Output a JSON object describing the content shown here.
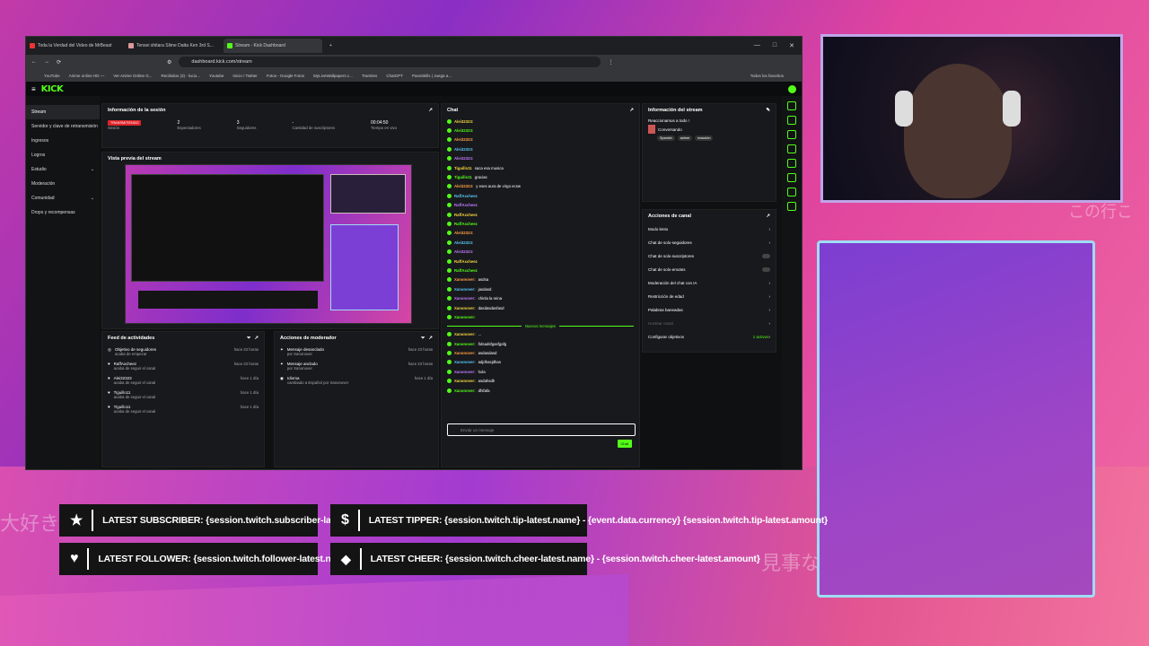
{
  "overlay": {
    "subscriber": "LATEST SUBSCRIBER: {session.twitch.subscriber-latest.name}",
    "follower": "LATEST FOLLOWER: {session.twitch.follower-latest.name}",
    "tipper": "LATEST TIPPER: {session.twitch.tip-latest.name} - {event.data.currency} {session.twitch.tip-latest.amount}",
    "cheer": "LATEST CHEER: {session.twitch.cheer-latest.name} - {session.twitch.cheer-latest.amount}",
    "jp_left": "大好き",
    "jp_right_top": "この行こ",
    "jp_right_bottom": "見事な"
  },
  "browser": {
    "tabs": [
      "Toda la Verdad del Video de MrBeast",
      "Tensei shitara Slime Datta Ken 3rd S...",
      "Stream - Kick Dashboard"
    ],
    "url": "dashboard.kick.com/stream",
    "bookmarks": [
      "YouTube",
      "Anime online HD —",
      "Ver Anime Online G...",
      "Recibidos (3) - lucio...",
      "Youtube",
      "Inicio / Twitter",
      "Fotos - Google Fotos",
      "MyLiveWallpapers.c...",
      "Tramites",
      "ChatGPT",
      "PassSkills | Juega a...",
      "Todos los favoritos"
    ]
  },
  "kick": {
    "logo": "KICK",
    "sidebar": [
      "Stream",
      "Servidor y clave de retransmisión",
      "Ingresos",
      "Logros",
      "Estudio",
      "Moderación",
      "Comunidad",
      "Drops y recompensas"
    ],
    "session": {
      "title": "Información de la sesión",
      "live_badge": "TRANSMITIENDO",
      "stats": [
        {
          "value": "",
          "label": "Sesión"
        },
        {
          "value": "2",
          "label": "Espectadores"
        },
        {
          "value": "3",
          "label": "Seguidores"
        },
        {
          "value": "-",
          "label": "Cantidad de suscriptores"
        },
        {
          "value": "00:04:50",
          "label": "Tiempo en vivo"
        }
      ]
    },
    "preview_title": "Vista previa del stream",
    "feed": {
      "title": "Feed de actividades",
      "items": [
        {
          "name": "Objetivo de seguidores",
          "desc": "acaba de empezar",
          "time": "hace 23 horas"
        },
        {
          "name": "RaffAxcheez",
          "desc": "acaba de seguir el canal",
          "time": "hace 23 horas"
        },
        {
          "name": "Alei32323",
          "desc": "acaba de seguir el canal",
          "time": "hace 1 día"
        },
        {
          "name": "Tiguillo11",
          "desc": "acaba de seguir el canal",
          "time": "hace 1 día"
        },
        {
          "name": "Tiguillo11",
          "desc": "acaba de seguir el canal",
          "time": "hace 1 día"
        }
      ]
    },
    "mod": {
      "title": "Acciones de moderador",
      "items": [
        {
          "name": "Mensaje desanclado",
          "desc": "por Xanonover",
          "time": "hace 23 horas"
        },
        {
          "name": "Mensaje anclado",
          "desc": "por Xanonover",
          "time": "hace 23 horas"
        },
        {
          "name": "Idioma",
          "desc": "cambiado a Español por Xanonover",
          "time": "hace 1 día"
        }
      ]
    },
    "chat": {
      "title": "Chat",
      "lines": [
        {
          "u": "Alei32323:",
          "t": ""
        },
        {
          "u": "Alei32323:",
          "t": ""
        },
        {
          "u": "Alei32323:",
          "t": ""
        },
        {
          "u": "Alei32323:",
          "t": ""
        },
        {
          "u": "Alei32323:",
          "t": ""
        },
        {
          "u": "Tiguillo11",
          "t": "saca esa musica"
        },
        {
          "u": "Tiguillo11",
          "t": "gracias"
        },
        {
          "u": "Alei32323:",
          "t": "y eses aura de virgo ecsw"
        },
        {
          "u": "RaffAxcheez",
          "t": ""
        },
        {
          "u": "RaffAxcheez",
          "t": ""
        },
        {
          "u": "RaffAxcheez",
          "t": ""
        },
        {
          "u": "RaffAxcheez",
          "t": ""
        },
        {
          "u": "Alei32323:",
          "t": ""
        },
        {
          "u": "Alei32323:",
          "t": ""
        },
        {
          "u": "Alei32323:",
          "t": ""
        },
        {
          "u": "RaffAxcheez",
          "t": ""
        },
        {
          "u": "RaffAxcheez",
          "t": ""
        },
        {
          "u": "Xanonover:",
          "t": "asdsa"
        },
        {
          "u": "Xanonover:",
          "t": "jasdasd"
        },
        {
          "u": "Xanonover:",
          "t": "chinla la reina"
        },
        {
          "u": "Xanonover:",
          "t": "dasdasdasfasd"
        },
        {
          "u": "Xanonover:",
          "t": ""
        }
      ],
      "divider": "Nuevos mensajes",
      "new_lines": [
        {
          "u": "Xanonover:",
          "t": "..."
        },
        {
          "u": "Xanonover:",
          "t": "ñdsadsfgasfgafg"
        },
        {
          "u": "Xanonover:",
          "t": "asdasdasd"
        },
        {
          "u": "Xanonover:",
          "t": "adjdhasjdhas"
        },
        {
          "u": "Xanonover:",
          "t": "hola"
        },
        {
          "u": "Xanonover:",
          "t": "asdahsdh"
        },
        {
          "u": "Xanonover:",
          "t": "dfsfafa"
        }
      ],
      "placeholder": "Enviar un mensaje",
      "send": "Chat"
    },
    "stream_info": {
      "title": "Información del stream",
      "desc": "Reaccionamos a todo !",
      "category": "Conversando",
      "tags": [
        "Spanish",
        "anime",
        "reacción"
      ]
    },
    "actions": {
      "title": "Acciones de canal",
      "items": [
        "Modo lento",
        "Chat de solo-seguidores",
        "Chat de solo-suscriptores",
        "Chat de solo-emotes",
        "Moderación del chat con IA",
        "Restricción de edad",
        "Palabras baneadas",
        "Hostear canal",
        "Configurar objetivos"
      ],
      "goals_state": "1 activos"
    }
  }
}
